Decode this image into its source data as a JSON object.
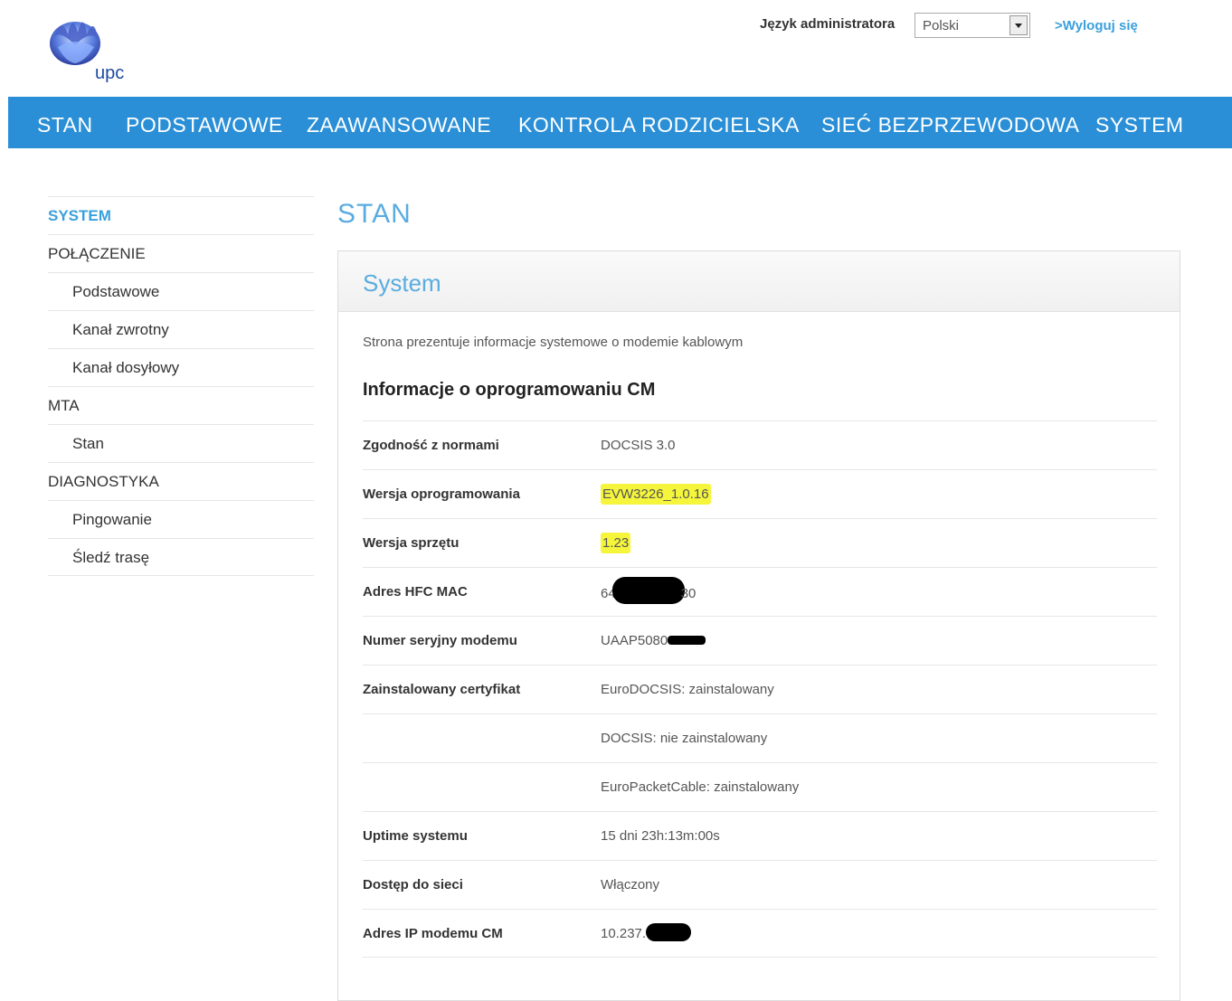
{
  "header": {
    "brand": "upc",
    "lang_label": "Język administratora",
    "lang_value": "Polski",
    "logout": ">Wyloguj się"
  },
  "nav": {
    "items": [
      "STAN",
      "PODSTAWOWE",
      "ZAAWANSOWANE",
      "KONTROLA RODZICIELSKA",
      "SIEĆ BEZPRZEWODOWA",
      "SYSTEM"
    ]
  },
  "sidebar": {
    "items": [
      "SYSTEM",
      "POŁĄCZENIE",
      "Podstawowe",
      "Kanał zwrotny",
      "Kanał dosyłowy",
      "MTA",
      "Stan",
      "DIAGNOSTYKA",
      "Pingowanie",
      "Śledź trasę"
    ]
  },
  "main": {
    "title": "STAN",
    "panel_title": "System",
    "description": "Strona prezentuje informacje systemowe o modemie kablowym",
    "section_title": "Informacje o oprogramowaniu CM",
    "rows": [
      {
        "label": "Zgodność z normami",
        "value": "DOCSIS 3.0"
      },
      {
        "label": "Wersja oprogramowania",
        "value": "EVW3226_1.0.16"
      },
      {
        "label": "Wersja sprzętu",
        "value": "1.23"
      },
      {
        "label": "Adres HFC MAC",
        "value_prefix": "64",
        "value_suffix": "30"
      },
      {
        "label": "Numer seryjny modemu",
        "value_prefix": "UAAP5080"
      },
      {
        "label": "Zainstalowany certyfikat",
        "value": "EuroDOCSIS: zainstalowany"
      },
      {
        "label": "",
        "value": "DOCSIS: nie zainstalowany"
      },
      {
        "label": "",
        "value": "EuroPacketCable: zainstalowany"
      },
      {
        "label": "Uptime systemu",
        "value": "15 dni 23h:13m:00s"
      },
      {
        "label": "Dostęp do sieci",
        "value": "Włączony"
      },
      {
        "label": "Adres IP modemu CM",
        "value_prefix": "10.237."
      }
    ]
  },
  "colors": {
    "nav_bg": "#2a8fd6",
    "accent": "#3aa0dc",
    "title": "#5aace0",
    "highlight": "#f5f53c"
  }
}
